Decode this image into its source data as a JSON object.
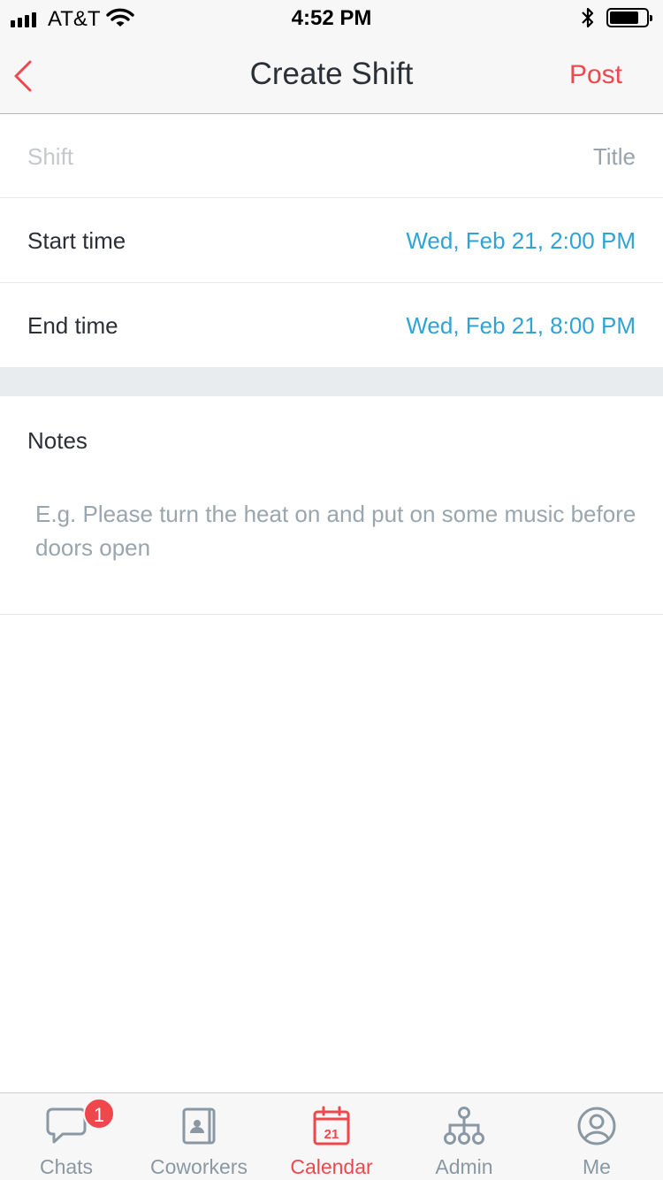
{
  "status_bar": {
    "carrier": "AT&T",
    "time": "4:52 PM",
    "battery_level": 0.8
  },
  "nav": {
    "title": "Create Shift",
    "post_label": "Post"
  },
  "form": {
    "shift_placeholder": "Shift",
    "shift_value_label": "Title",
    "start_label": "Start time",
    "start_value": "Wed, Feb 21, 2:00 PM",
    "end_label": "End time",
    "end_value": "Wed, Feb 21, 8:00 PM",
    "notes_label": "Notes",
    "notes_placeholder": "E.g. Please turn the heat on and put on some music before doors open"
  },
  "tabs": [
    {
      "label": "Chats",
      "icon": "chat-bubble-icon",
      "badge": "1"
    },
    {
      "label": "Coworkers",
      "icon": "contact-book-icon"
    },
    {
      "label": "Calendar",
      "icon": "calendar-icon",
      "icon_text": "21",
      "active": true
    },
    {
      "label": "Admin",
      "icon": "org-chart-icon"
    },
    {
      "label": "Me",
      "icon": "profile-icon"
    }
  ],
  "colors": {
    "accent": "#f0474d",
    "link": "#2fa3d6",
    "tab_inactive": "#8a98a3"
  }
}
